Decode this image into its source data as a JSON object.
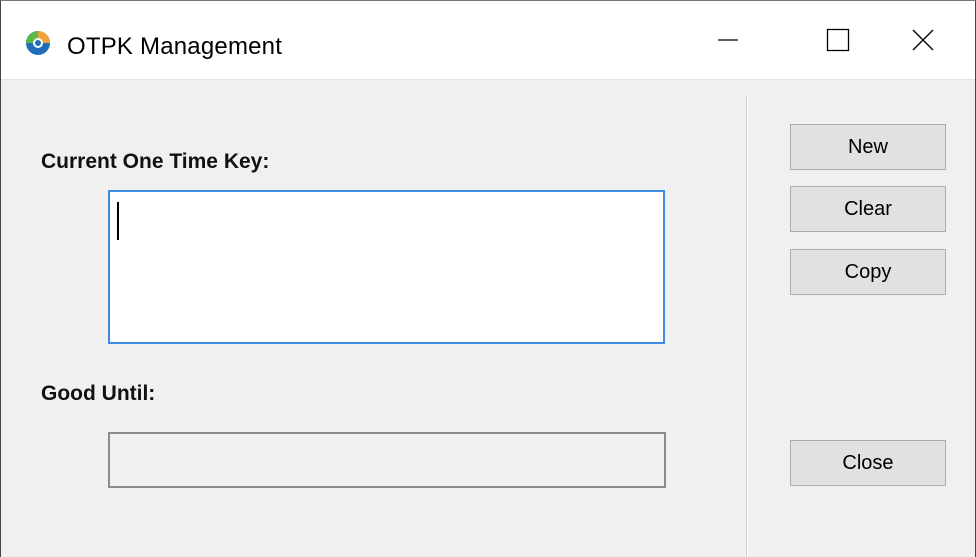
{
  "window": {
    "title": "OTPK Management",
    "app_icon": "otpk-app-icon",
    "caption_buttons": [
      "minimize-icon",
      "maximize-icon",
      "close-icon"
    ]
  },
  "form": {
    "current_key_label": "Current One Time Key:",
    "current_key_value": "",
    "good_until_label": "Good Until:",
    "good_until_value": ""
  },
  "buttons": {
    "new": "New",
    "clear": "Clear",
    "copy": "Copy",
    "close": "Close"
  },
  "colors": {
    "focus_border": "#3e8be0",
    "window_bg": "#f0f0f0",
    "button_bg": "#e1e1e1"
  }
}
